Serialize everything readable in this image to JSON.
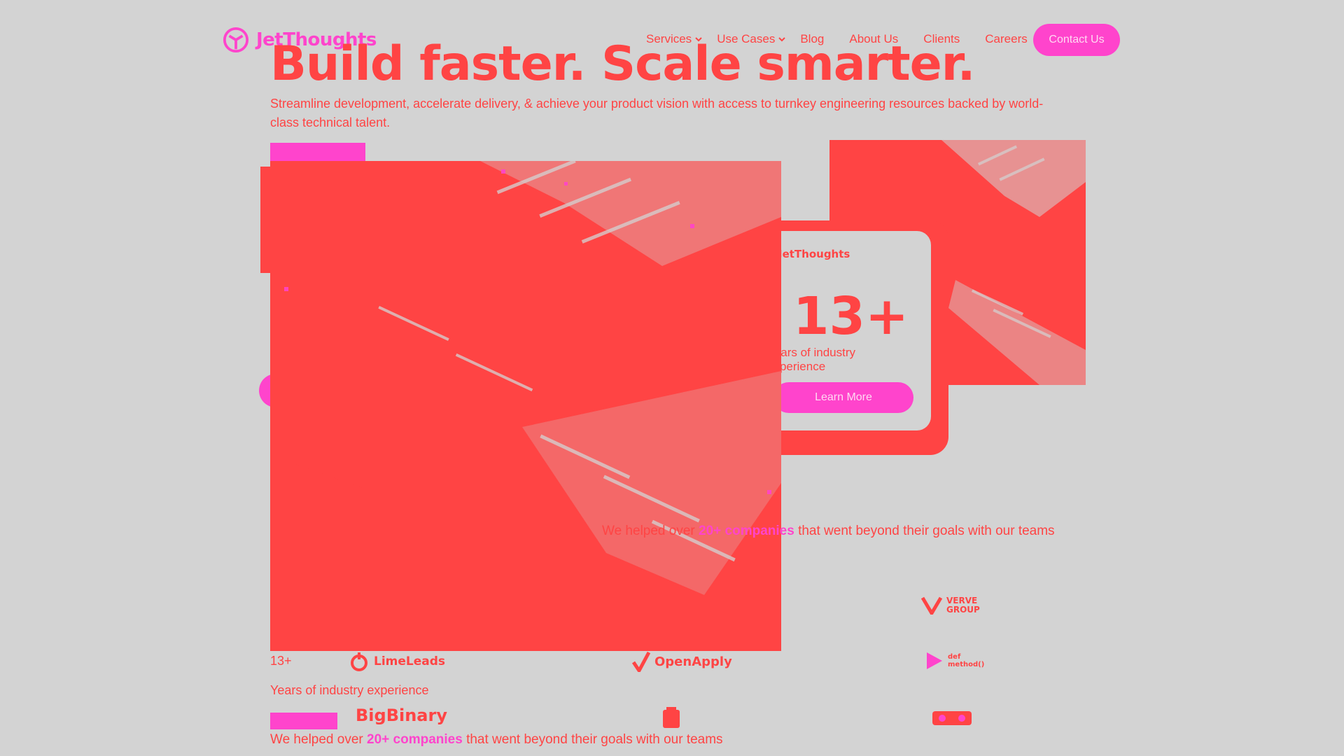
{
  "brand": {
    "name": "JetThoughts"
  },
  "nav": {
    "items": [
      {
        "label": "Services",
        "dropdown": true
      },
      {
        "label": "Use Cases",
        "dropdown": true
      },
      {
        "label": "Blog",
        "dropdown": false
      },
      {
        "label": "About Us",
        "dropdown": false
      },
      {
        "label": "Clients",
        "dropdown": false
      },
      {
        "label": "Careers",
        "dropdown": false
      }
    ],
    "contact_label": "Contact Us"
  },
  "hero": {
    "title": "Build faster. Scale smarter.",
    "subtitle": "Streamline development, accelerate delivery, & achieve your product vision with access to turnkey engineering resources backed by world-class technical talent."
  },
  "stats_card": {
    "brand": "JetThoughts",
    "number": "13+",
    "label": "Years of industry experience",
    "button_label": "Learn More"
  },
  "stats_small": {
    "number": "13+",
    "label": "Years of industry experience"
  },
  "helped": {
    "prefix": "We helped over ",
    "highlight": "20+ companies",
    "suffix": " that went beyond their goals with our teams"
  },
  "clients": {
    "limeleads": "LimeLeads",
    "openapply": "OpenApply",
    "bigbinary": "BigBinary",
    "verve": "VERVE GROUP",
    "defmethod": "def method()"
  },
  "colors": {
    "red": "#ff4444",
    "pink": "#ff44cc",
    "bg": "#d3d3d3"
  }
}
